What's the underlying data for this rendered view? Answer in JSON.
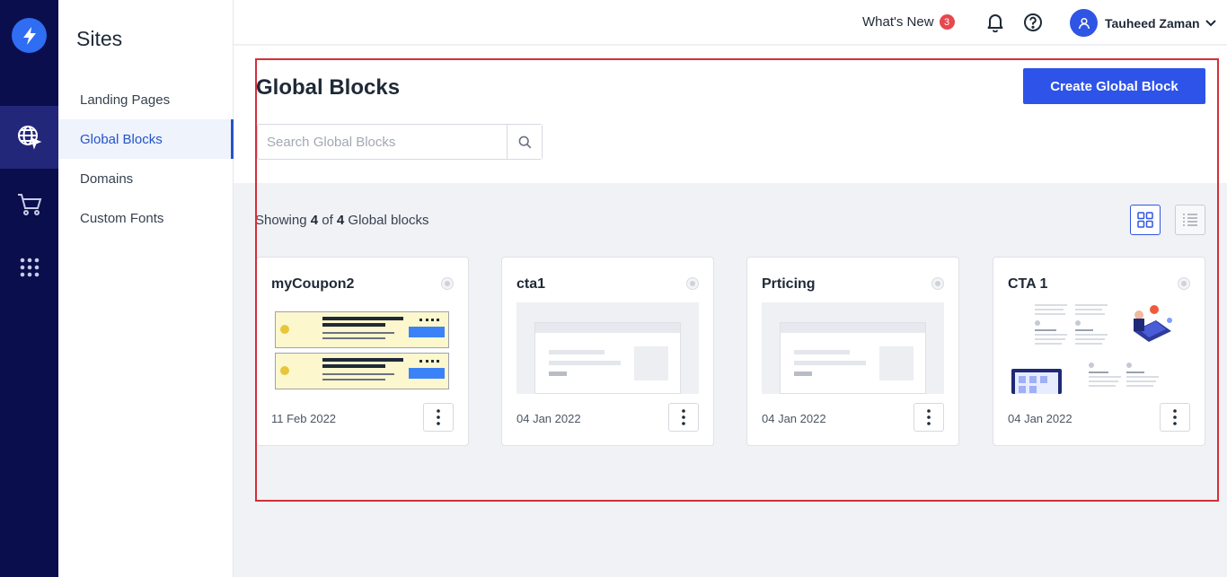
{
  "sidebar": {
    "title": "Sites",
    "items": [
      {
        "label": "Landing Pages",
        "active": false
      },
      {
        "label": "Global Blocks",
        "active": true
      },
      {
        "label": "Domains",
        "active": false
      },
      {
        "label": "Custom Fonts",
        "active": false
      }
    ]
  },
  "rail": {
    "icons": [
      "bolt-logo-icon",
      "globe-cursor-icon",
      "cart-icon",
      "apps-grid-icon"
    ]
  },
  "header": {
    "whats_new_label": "What's New",
    "whats_new_count": "3",
    "user_name": "Tauheed Zaman"
  },
  "page": {
    "title": "Global Blocks",
    "create_button": "Create Global Block",
    "search_placeholder": "Search Global Blocks",
    "showing_prefix": "Showing ",
    "showing_count": "4",
    "showing_of": " of ",
    "showing_total": "4",
    "showing_suffix": " Global blocks"
  },
  "blocks": [
    {
      "title": "myCoupon2",
      "date": "11 Feb 2022",
      "thumbnail": "coupon"
    },
    {
      "title": "cta1",
      "date": "04 Jan 2022",
      "thumbnail": "wireframe"
    },
    {
      "title": "Prticing",
      "date": "04 Jan 2022",
      "thumbnail": "wireframe"
    },
    {
      "title": "CTA 1",
      "date": "04 Jan 2022",
      "thumbnail": "illustration"
    }
  ],
  "colors": {
    "rail": "#0b0e4d",
    "accent": "#2e53e8",
    "highlight": "#d32f3a",
    "badge": "#e5484d"
  }
}
